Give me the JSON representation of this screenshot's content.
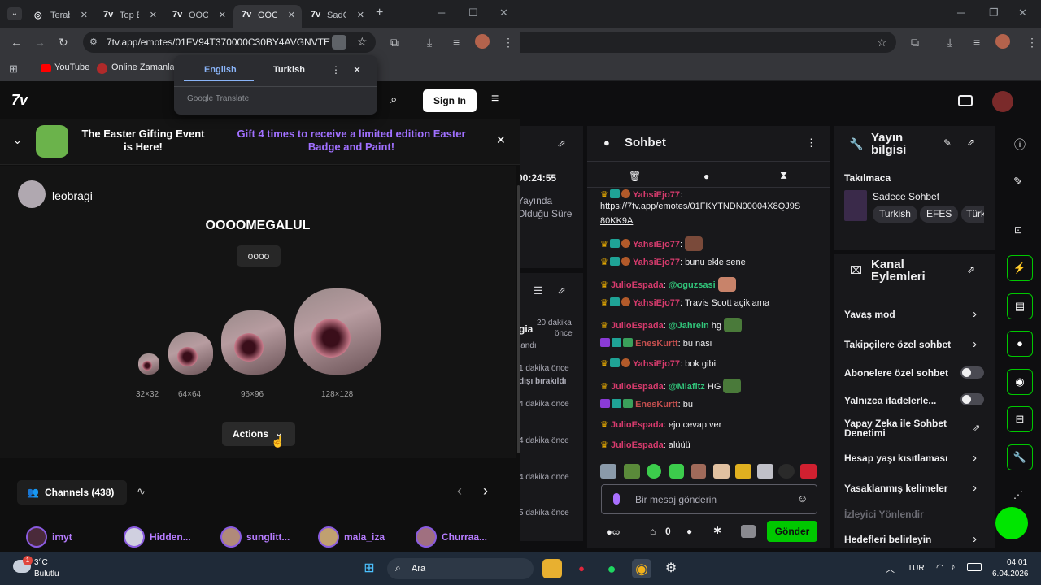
{
  "front_tabs": [
    {
      "label": "Terabi",
      "fav": "◎"
    },
    {
      "label": "Top E",
      "fav": "7v"
    },
    {
      "label": "OOO(",
      "fav": "7v"
    },
    {
      "label": "OOO(",
      "fav": "7v"
    },
    {
      "label": "SadC",
      "fav": "7v"
    }
  ],
  "url": "7tv.app/emotes/01FV94T370000C30BY4AVGNVTE",
  "bookmarks": [
    {
      "label": "YouTube"
    },
    {
      "label": "Online Zamanlay"
    }
  ],
  "translate": {
    "tab_english": "English",
    "tab_turkish": "Turkish",
    "footer": "Google Translate"
  },
  "site": {
    "logo": "7v",
    "signin": "Sign In"
  },
  "banner": {
    "title": "The Easter Gifting Event is Here!",
    "message": "Gift 4 times to receive a limited edition Easter Badge and Paint!"
  },
  "emote": {
    "owner": "leobragi",
    "name": "OOOOMEGALUL",
    "tag": "oooo",
    "sizes": [
      "32×32",
      "64×64",
      "96×96",
      "128×128"
    ],
    "actions_label": "Actions"
  },
  "channels": {
    "tab_label": "Channels (438)",
    "list": [
      {
        "name": "imyt"
      },
      {
        "name": "Hidden..."
      },
      {
        "name": "sunglitt..."
      },
      {
        "name": "mala_iza"
      },
      {
        "name": "Churraa..."
      }
    ]
  },
  "left_panel": {
    "timer": "00:24:55",
    "line1": "Yayında",
    "line2": "Olduğu Süre",
    "events": [
      {
        "a": "gia",
        "b": "20 dakika",
        "c": "önce",
        "d": "landı"
      },
      {
        "a": "",
        "b": "1 dakika önce",
        "c": "",
        "d": "dışı bırakıldı"
      },
      {
        "b": "4 dakika önce"
      },
      {
        "b": "4 dakika önce"
      },
      {
        "b": "4 dakika önce"
      },
      {
        "b": "5 dakika önce"
      }
    ]
  },
  "chat": {
    "title": "Sohbet",
    "messages": [
      {
        "user": "YahsiEjo77",
        "text": ":",
        "link": "https://7tv.app/emotes/01FKYTNDN00004X8QJ9S",
        "link2": "80KK9A"
      },
      {
        "user": "YahsiEjo77",
        "text": ":"
      },
      {
        "user": "YahsiEjo77",
        "text": ": bunu ekle sene"
      },
      {
        "user": "JulioEspada",
        "mention": "@oguzsasi",
        "text": ""
      },
      {
        "user": "YahsiEjo77",
        "text": ": Travis Scott açiklama"
      },
      {
        "user": "JulioEspada",
        "mention": "@Jahrein",
        "text": " hg"
      },
      {
        "user": "EnesKurtt",
        "text": ": bu nasi"
      },
      {
        "user": "YahsiEjo77",
        "text": ": bok gibi"
      },
      {
        "user": "JulioEspada",
        "mention": "@Miafitz",
        "text": " HG"
      },
      {
        "user": "EnesKurtt",
        "text": ": bu"
      },
      {
        "user": "JulioEspada",
        "text": ": ejo cevap ver"
      },
      {
        "user": "JulioEspada",
        "text": ": alüüü"
      }
    ],
    "input_placeholder": "Bir mesaj gönderin",
    "points": "0",
    "send_label": "Gönder"
  },
  "stream_info": {
    "title": "Yayın bilgisi",
    "category_label": "Takılmaca",
    "stream_title": "Sadece Sohbet",
    "tags": [
      "Turkish",
      "EFES",
      "Türk"
    ]
  },
  "channel_actions": {
    "title": "Kanal Eylemleri",
    "items": [
      {
        "label": "Yavaş mod"
      },
      {
        "label": "Takipçilere özel sohbet"
      },
      {
        "label": "Abonelere özel sohbet"
      },
      {
        "label": "Yalnızca ifadelerle..."
      },
      {
        "label": "Yapay Zeka ile Sohbet Denetimi"
      },
      {
        "label": "Hesap yaşı kısıtlaması"
      },
      {
        "label": "Yasaklanmış kelimeler"
      },
      {
        "label": "İzleyici Yönlendir"
      },
      {
        "label": "Hedefleri belirleyin"
      }
    ]
  },
  "taskbar": {
    "weather_temp": "3°C",
    "weather_text": "Bulutlu",
    "weather_badge": "1",
    "search_label": "Ara",
    "lang": "TUR",
    "time": "04:01",
    "date": "6.04.2026"
  }
}
